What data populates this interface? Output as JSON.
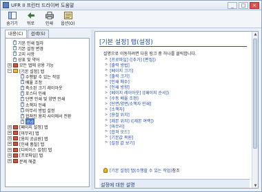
{
  "window": {
    "title": "UFR II 프린터 드라이버 도움말"
  },
  "toolbar": {
    "buttons": [
      {
        "label": "숨기기",
        "icon": "hide-icon"
      },
      {
        "label": "뒤로",
        "icon": "back-arrow-icon"
      },
      {
        "label": "인쇄",
        "icon": "printer-icon"
      },
      {
        "label": "옵션(O)",
        "icon": "options-icon"
      }
    ]
  },
  "tabs": {
    "contents": "내용(C)",
    "search": "검색(S)"
  },
  "tree": {
    "items": [
      {
        "label": "기본 인쇄 절차"
      },
      {
        "label": "기본 설정 변경"
      },
      {
        "label": "고지 사항"
      },
      {
        "label": "상표 및 약어"
      },
      {
        "label": "모든 탭에 공용 기능"
      },
      {
        "label": "[기본 설정] 탭"
      },
      {
        "label": "수행할 수 있는 작업"
      },
      {
        "label": "배율 조정"
      },
      {
        "label": "축소된 크기 레이아웃"
      },
      {
        "label": "포스터 인쇄"
      },
      {
        "label": "단면 인쇄 및 양면 인쇄"
      },
      {
        "label": "소책자 인쇄"
      },
      {
        "label": "마무리 방법 설정"
      },
      {
        "label": "합쳐진 용지 사이에서 전환"
      },
      {
        "label": "공급"
      },
      {
        "label": "[페이지 설정] 탭"
      },
      {
        "label": "[마무리] 탭"
      },
      {
        "label": "[용지 공급원] 탭"
      },
      {
        "label": "[인쇄 품질] 탭"
      },
      {
        "label": "[디바이스 설정] 탭"
      },
      {
        "label": "[프로파일] 탭"
      },
      {
        "label": "문제 해결"
      }
    ]
  },
  "content": {
    "heading": "[기본 설정] 탭(설정)",
    "intro": "설명으로 이동하려면 다음 링크 중 하나를 클릭합니다.",
    "links": [
      "[프로파일] ([추가] [편집])",
      "[출력 방법]",
      "[페이지 크기]",
      "[출력 크기]",
      "[인쇄 매수]",
      "[인쇄 방향]",
      "[페이지 레이아웃] ([페이지 순서])",
      "[수동 배율 조정]",
      "[단면/양면/소책자 인쇄]",
      "[소책자]",
      "[용철 위치]",
      "[제본 위치] ([제본 여백])",
      "[마무리]",
      "[합쳐 모드]",
      "[기본값 복원]",
      "[설정 값 보기]"
    ],
    "note_link": "[기본 설정] 탭(수행할 수 있는 작업)",
    "note_rest": " 참조",
    "section_title": "설정에 대한 설명"
  }
}
